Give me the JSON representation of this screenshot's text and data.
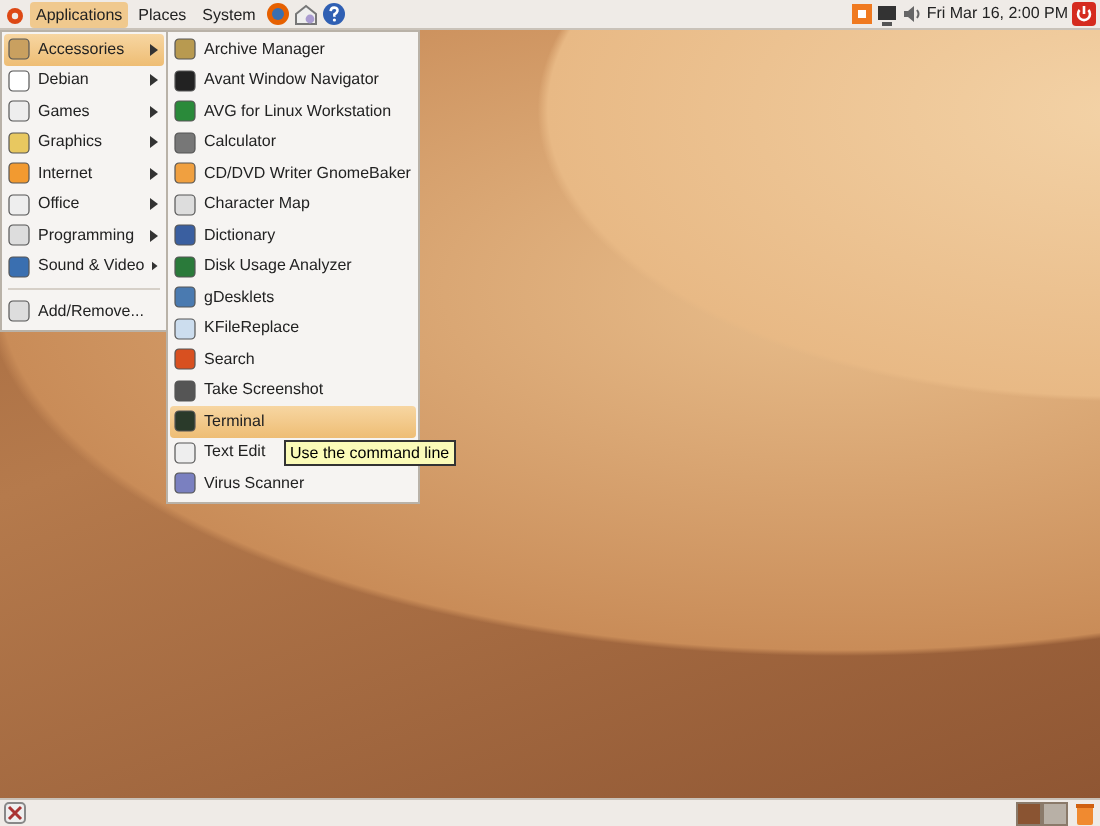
{
  "top_panel": {
    "menus": [
      {
        "label": "Applications",
        "selected": true
      },
      {
        "label": "Places",
        "selected": false
      },
      {
        "label": "System",
        "selected": false
      }
    ],
    "clock": "Fri Mar 16,  2:00 PM"
  },
  "applications_menu": {
    "items": [
      {
        "kind": "item",
        "label": "Accessories",
        "submenu": true,
        "selected": true
      },
      {
        "kind": "item",
        "label": "Debian",
        "submenu": true,
        "selected": false
      },
      {
        "kind": "item",
        "label": "Games",
        "submenu": true,
        "selected": false
      },
      {
        "kind": "item",
        "label": "Graphics",
        "submenu": true,
        "selected": false
      },
      {
        "kind": "item",
        "label": "Internet",
        "submenu": true,
        "selected": false
      },
      {
        "kind": "item",
        "label": "Office",
        "submenu": true,
        "selected": false
      },
      {
        "kind": "item",
        "label": "Programming",
        "submenu": true,
        "selected": false
      },
      {
        "kind": "item",
        "label": "Sound & Video",
        "submenu": true,
        "selected": false
      },
      {
        "kind": "separator"
      },
      {
        "kind": "item",
        "label": "Add/Remove...",
        "submenu": false,
        "selected": false
      }
    ]
  },
  "accessories_menu": {
    "items": [
      {
        "label": "Archive Manager",
        "selected": false
      },
      {
        "label": "Avant Window Navigator",
        "selected": false
      },
      {
        "label": "AVG for Linux Workstation",
        "selected": false
      },
      {
        "label": "Calculator",
        "selected": false
      },
      {
        "label": "CD/DVD Writer GnomeBaker",
        "selected": false
      },
      {
        "label": "Character Map",
        "selected": false
      },
      {
        "label": "Dictionary",
        "selected": false
      },
      {
        "label": "Disk Usage Analyzer",
        "selected": false
      },
      {
        "label": "gDesklets",
        "selected": false
      },
      {
        "label": "KFileReplace",
        "selected": false
      },
      {
        "label": "Search",
        "selected": false
      },
      {
        "label": "Take Screenshot",
        "selected": false
      },
      {
        "label": "Terminal",
        "selected": true
      },
      {
        "label": "Text Edit",
        "selected": false
      },
      {
        "label": "Virus Scanner",
        "selected": false
      }
    ]
  },
  "tooltip": "Use the command line",
  "bottom_panel": {
    "workspaces": [
      {
        "selected": true
      },
      {
        "selected": false
      }
    ]
  }
}
